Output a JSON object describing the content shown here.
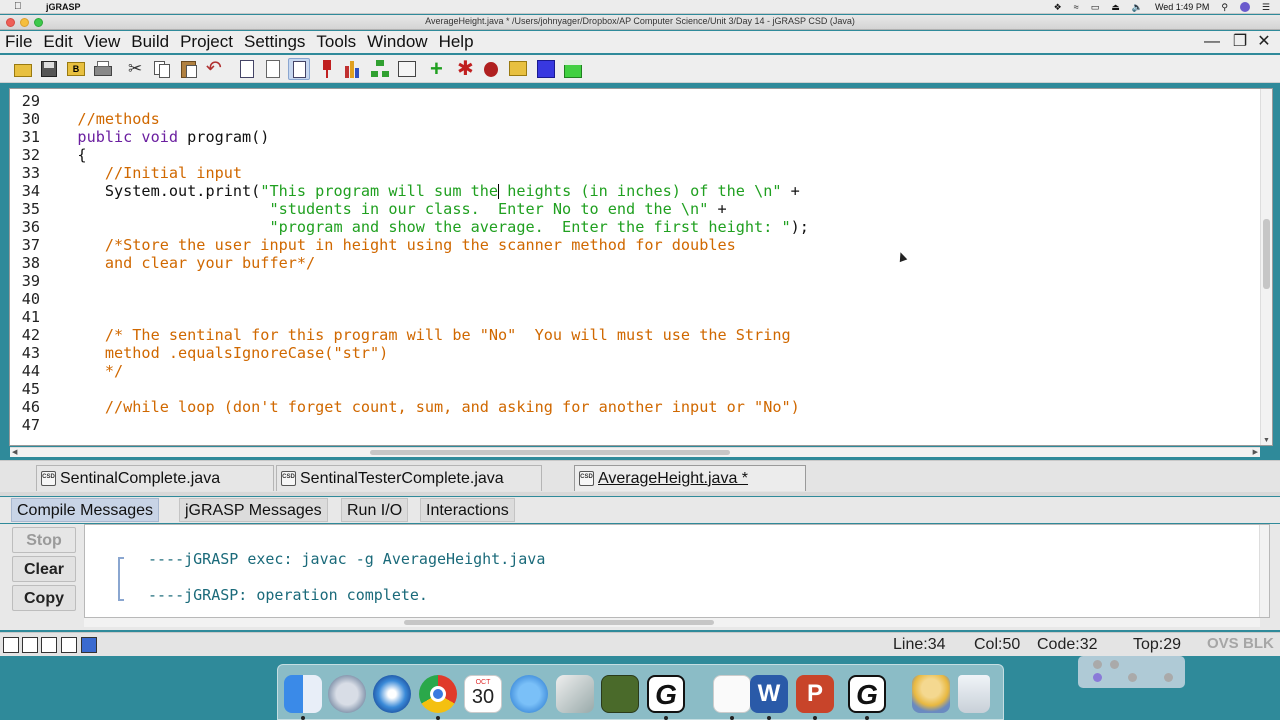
{
  "mac_menubar": {
    "app_name": "jGRASP",
    "clock": "Wed 1:49 PM"
  },
  "window": {
    "title": "AverageHeight.java *  /Users/johnyager/Dropbox/AP Computer Science/Unit 3/Day 14 - jGRASP CSD (Java)"
  },
  "menu": {
    "items": [
      "File",
      "Edit",
      "View",
      "Build",
      "Project",
      "Settings",
      "Tools",
      "Window",
      "Help"
    ]
  },
  "editor": {
    "lines": [
      {
        "num": "29",
        "segments": []
      },
      {
        "num": "30",
        "segments": [
          {
            "t": "   //methods",
            "c": "cm"
          }
        ]
      },
      {
        "num": "31",
        "segments": [
          {
            "t": "   public void ",
            "c": "kw"
          },
          {
            "t": "program()",
            "c": "pl"
          }
        ]
      },
      {
        "num": "32",
        "segments": [
          {
            "t": "   {",
            "c": "pl"
          }
        ]
      },
      {
        "num": "33",
        "segments": [
          {
            "t": "      //Initial input",
            "c": "cm"
          }
        ]
      },
      {
        "num": "34",
        "segments": [
          {
            "t": "      System.out.print(",
            "c": "pl"
          },
          {
            "t": "\"This program will sum the",
            "c": "st"
          },
          {
            "t": "CARET",
            "c": "caret"
          },
          {
            "t": " heights (in inches) of the \\n\"",
            "c": "st"
          },
          {
            "t": " +",
            "c": "pl"
          }
        ]
      },
      {
        "num": "35",
        "segments": [
          {
            "t": "                        \"students in our class.  Enter No to end the \\n\"",
            "c": "st"
          },
          {
            "t": " +",
            "c": "pl"
          }
        ]
      },
      {
        "num": "36",
        "segments": [
          {
            "t": "                        \"program and show the average.  Enter the first height: \"",
            "c": "st"
          },
          {
            "t": ");",
            "c": "pl"
          }
        ]
      },
      {
        "num": "37",
        "segments": [
          {
            "t": "      /*Store the user input in height using the scanner method for doubles",
            "c": "cm"
          }
        ]
      },
      {
        "num": "38",
        "segments": [
          {
            "t": "      and clear your buffer*/",
            "c": "cm"
          }
        ]
      },
      {
        "num": "39",
        "segments": []
      },
      {
        "num": "40",
        "segments": []
      },
      {
        "num": "41",
        "segments": []
      },
      {
        "num": "42",
        "segments": [
          {
            "t": "      /* The sentinal for this program will be \"No\"  You will must use the String",
            "c": "cm"
          }
        ]
      },
      {
        "num": "43",
        "segments": [
          {
            "t": "      method .equalsIgnoreCase(\"str\")",
            "c": "cm"
          }
        ]
      },
      {
        "num": "44",
        "segments": [
          {
            "t": "      */",
            "c": "cm"
          }
        ]
      },
      {
        "num": "45",
        "segments": []
      },
      {
        "num": "46",
        "segments": [
          {
            "t": "      //while loop (don't forget count, sum, and asking for another input or \"No\")",
            "c": "cm"
          }
        ]
      },
      {
        "num": "47",
        "segments": []
      }
    ]
  },
  "file_tabs": [
    {
      "label": "SentinalComplete.java",
      "active": false
    },
    {
      "label": "SentinalTesterComplete.java",
      "active": false
    },
    {
      "label": "AverageHeight.java *",
      "active": true
    }
  ],
  "csd_icon_text": "CSD",
  "message_tabs": [
    {
      "label": "Compile Messages",
      "active": true
    },
    {
      "label": "jGRASP Messages",
      "active": false
    },
    {
      "label": "Run I/O",
      "active": false
    },
    {
      "label": "Interactions",
      "active": false
    }
  ],
  "message_buttons": {
    "stop": "Stop",
    "clear": "Clear",
    "copy": "Copy"
  },
  "messages": [
    "----jGRASP exec: javac -g AverageHeight.java",
    "----jGRASP: operation complete."
  ],
  "status": {
    "line": "Line:34",
    "col": "Col:50",
    "code": "Code:32",
    "top": "Top:29",
    "ovs": "OVS",
    "blk": "BLK"
  },
  "dock": {
    "calendar_month": "OCT",
    "calendar_day": "30",
    "word_letter": "W",
    "ppt_letter": "P",
    "jgrasp_letter": "G"
  },
  "colors": {
    "comment": "#d06800",
    "keyword": "#6b1fa0",
    "string": "#20a020",
    "message": "#1a6a7a"
  }
}
